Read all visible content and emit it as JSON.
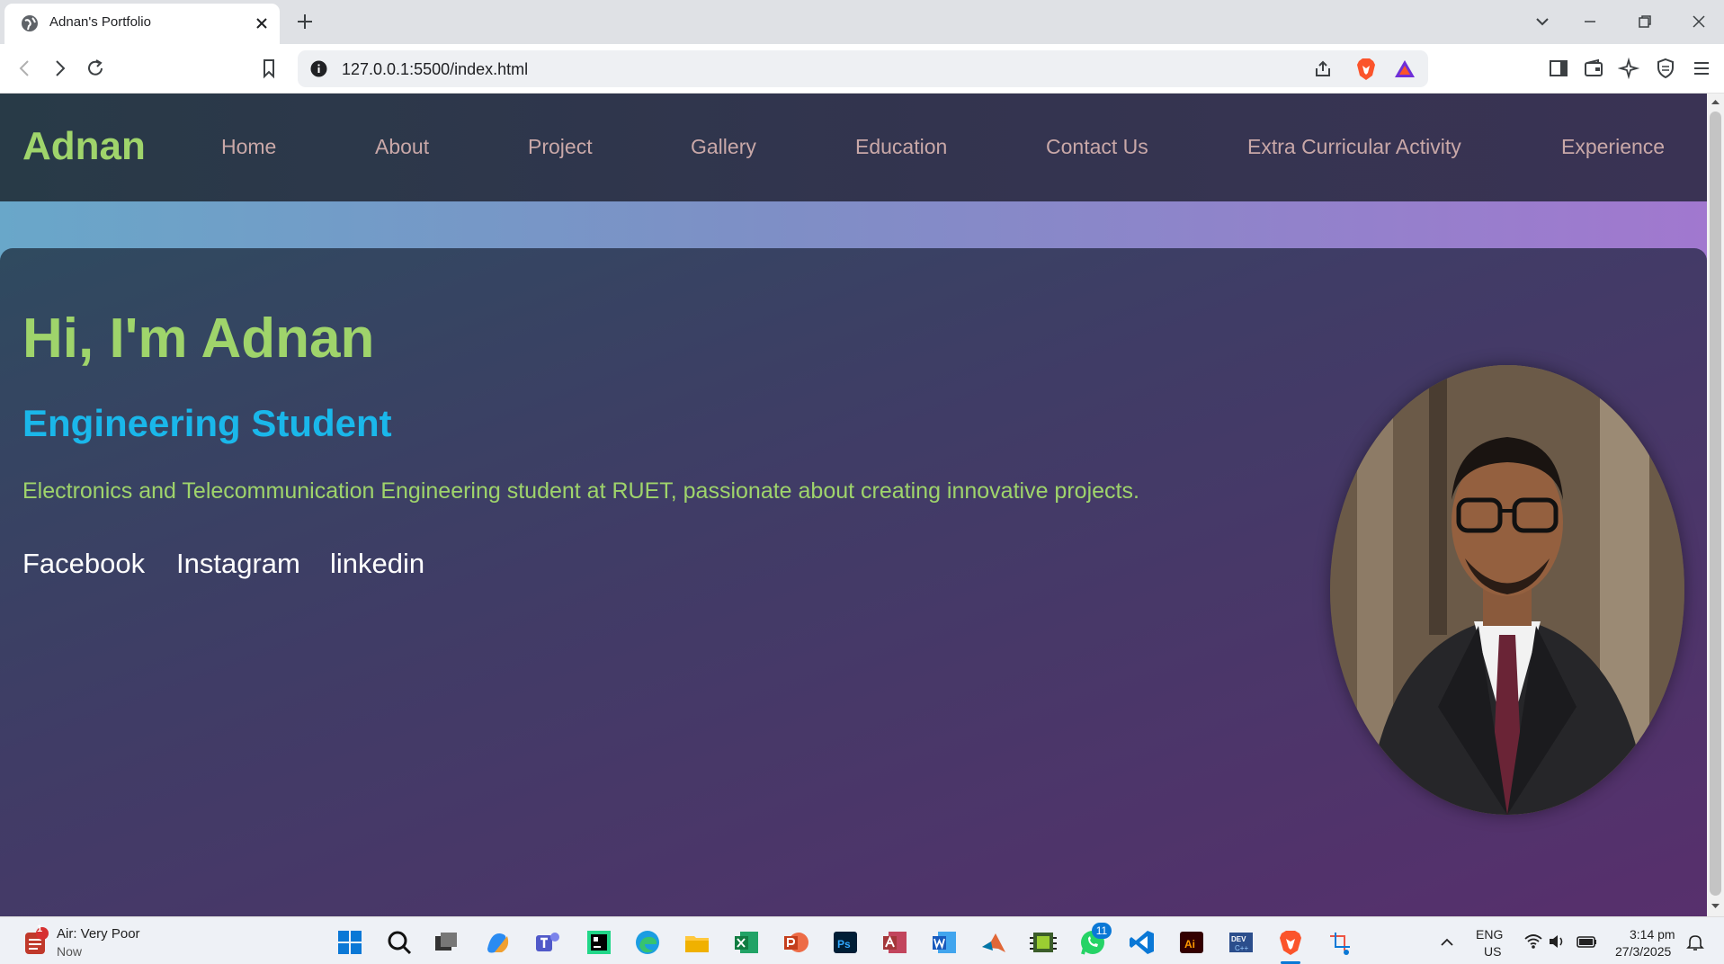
{
  "browser": {
    "tab_title": "Adnan's Portfolio",
    "url": "127.0.0.1:5500/index.html"
  },
  "page": {
    "brand": "Adnan",
    "nav": [
      "Home",
      "About",
      "Project",
      "Gallery",
      "Education",
      "Contact Us",
      "Extra Curricular Activity",
      "Experience"
    ],
    "greeting": "Hi, I'm Adnan",
    "role": "Engineering Student",
    "description": "Electronics and Telecommunication Engineering student at RUET, passionate about creating innovative projects.",
    "social": [
      "Facebook",
      "Instagram",
      "linkedin"
    ]
  },
  "taskbar": {
    "weather_title": "Air: Very Poor",
    "weather_sub": "Now",
    "weather_badge": "1",
    "whatsapp_badge": "11",
    "language": "ENG",
    "region": "US",
    "time": "3:14 pm",
    "date": "27/3/2025"
  },
  "colors": {
    "brand_green": "#9fd46b",
    "accent_blue": "#1ab7ea",
    "nav_text": "#c9a8a8"
  }
}
